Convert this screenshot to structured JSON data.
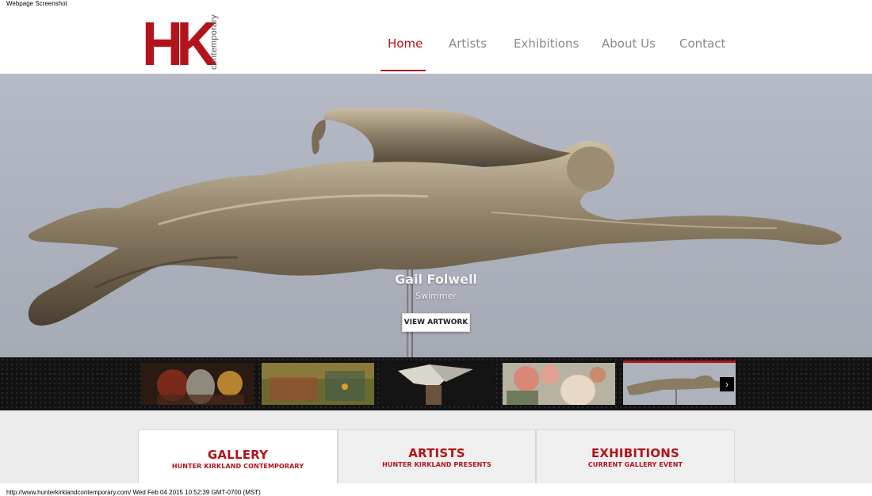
{
  "screenshot": {
    "top_caption": "Webpage Screenshot",
    "bottom_caption": "http://www.hunterkirklandcontemporary.com/ Wed Feb 04 2015 10:52:39 GMT-0700 (MST)"
  },
  "brand": {
    "logo_letters": "HK",
    "logo_sub": "contemporary",
    "accent_color": "#b3131b"
  },
  "nav": {
    "items": [
      {
        "label": "Home",
        "active": true
      },
      {
        "label": "Artists",
        "active": false
      },
      {
        "label": "Exhibitions",
        "active": false
      },
      {
        "label": "About Us",
        "active": false
      },
      {
        "label": "Contact",
        "active": false
      }
    ]
  },
  "hero": {
    "artist": "Gail Folwell",
    "title": "Swimmer",
    "button_label": "VIEW ARTWORK"
  },
  "thumbnails": {
    "count": 5,
    "active_index": 4,
    "next_icon": "chevron-right-icon"
  },
  "tiles": [
    {
      "title": "GALLERY",
      "subtitle": "HUNTER KIRKLAND CONTEMPORARY",
      "active": true
    },
    {
      "title": "ARTISTS",
      "subtitle": "HUNTER KIRKLAND PRESENTS",
      "active": false
    },
    {
      "title": "EXHIBITIONS",
      "subtitle": "CURRENT GALLERY EVENT",
      "active": false
    }
  ]
}
